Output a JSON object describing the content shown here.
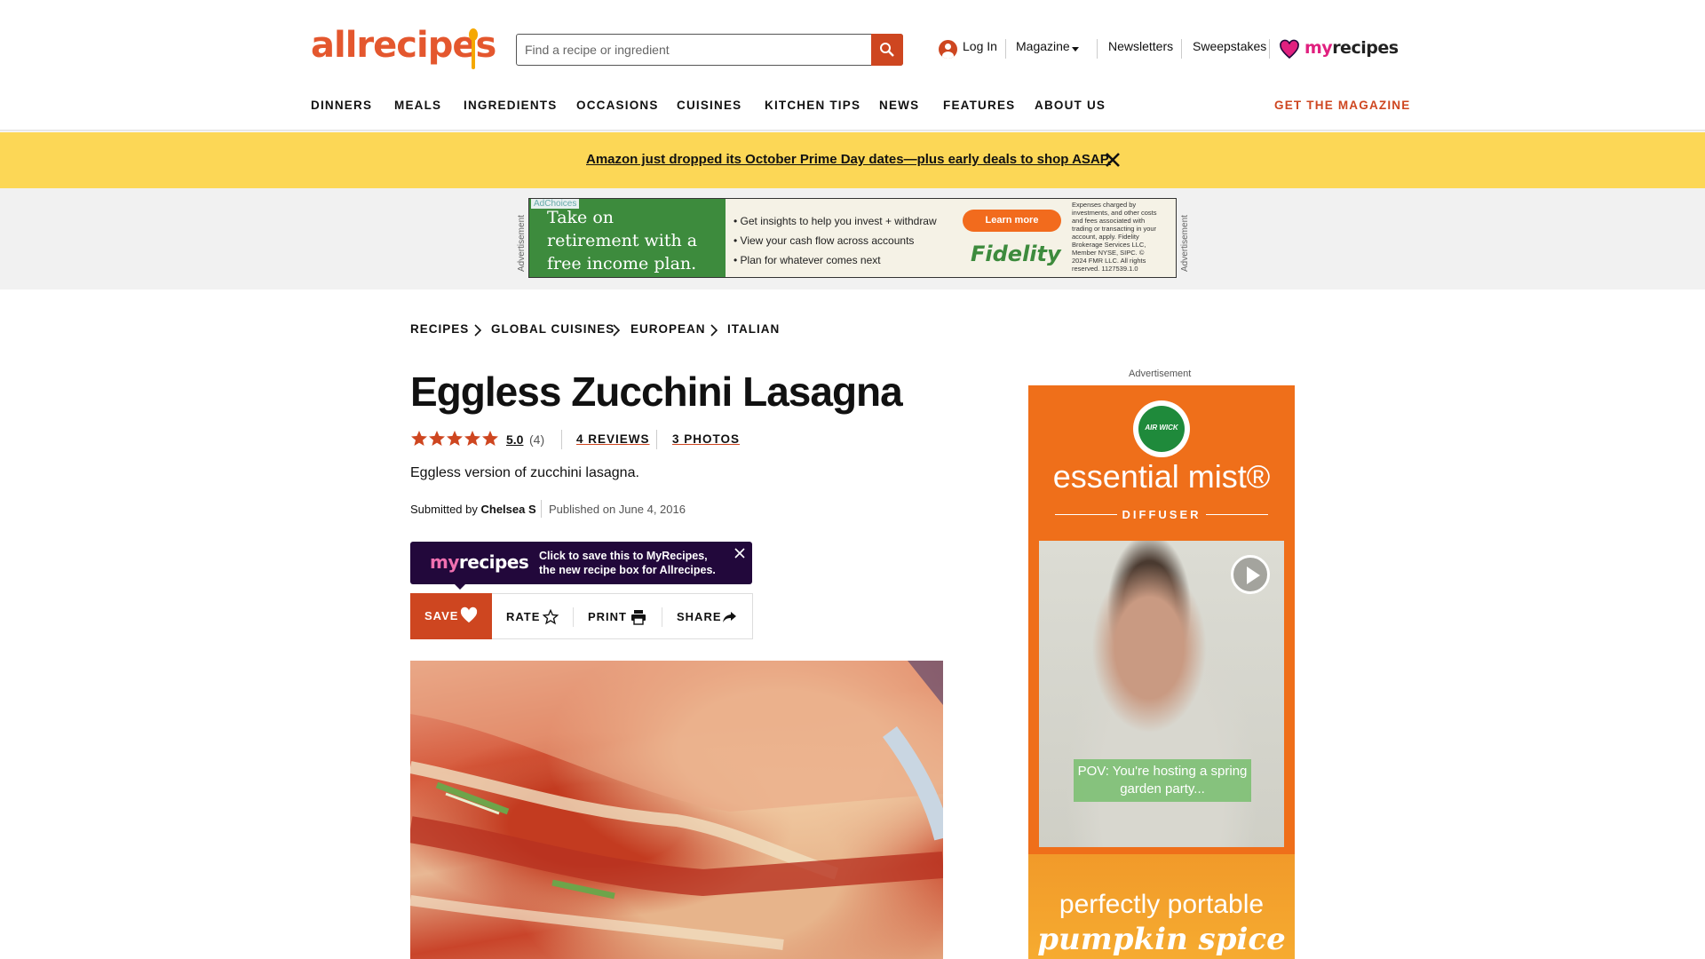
{
  "header": {
    "logo": "allrecipes",
    "search_placeholder": "Find a recipe or ingredient",
    "login": "Log In",
    "magazine": "Magazine",
    "newsletters": "Newsletters",
    "sweepstakes": "Sweepstakes",
    "myrecipes_my": "my",
    "myrecipes_rec": "recipes"
  },
  "nav": {
    "items": [
      "DINNERS",
      "MEALS",
      "INGREDIENTS",
      "OCCASIONS",
      "CUISINES",
      "KITCHEN TIPS",
      "NEWS",
      "FEATURES",
      "ABOUT US"
    ],
    "get_magazine": "GET THE MAGAZINE"
  },
  "banner": {
    "text": "Amazon just dropped its October Prime Day dates—plus early deals to shop ASAP."
  },
  "top_ad": {
    "label": "Advertisement",
    "adchoices": "AdChoices",
    "headline": "Take on retirement with a free income plan.",
    "bullets": [
      "• Get insights to help you invest + withdraw",
      "• View your cash flow across accounts",
      "• Plan for whatever comes next"
    ],
    "cta": "Learn more",
    "brand": "Fidelity",
    "fine_print": "Expenses charged by investments, and other costs and fees associated with trading or transacting in your account, apply. Fidelity Brokerage Services LLC, Member NYSE, SIPC. © 2024 FMR LLC. All rights reserved. 1127539.1.0"
  },
  "breadcrumb": [
    "RECIPES",
    "GLOBAL CUISINES",
    "EUROPEAN",
    "ITALIAN"
  ],
  "recipe": {
    "title": "Eggless Zucchini Lasagna",
    "rating": "5.0",
    "rating_value": 5,
    "rating_count": "(4)",
    "reviews": "4 REVIEWS",
    "photos": "3 PHOTOS",
    "description": "Eggless version of zucchini lasagna.",
    "submitted_by_label": "Submitted by",
    "author": "Chelsea S",
    "published": "Published on June 4, 2016"
  },
  "promo": {
    "logo_my": "my",
    "logo_rec": "recipes",
    "text_line1": "Click to save this to MyRecipes,",
    "text_line2": "the new recipe box for Allrecipes."
  },
  "actions": {
    "save": "SAVE",
    "rate": "RATE",
    "print": "PRINT",
    "share": "SHARE"
  },
  "side_ad": {
    "label": "Advertisement",
    "brand_badge": "AIR WICK",
    "product": "essential mist®",
    "subtitle": "DIFFUSER",
    "video_caption": "POV: You're hosting a spring garden party...",
    "tagline": "perfectly portable",
    "scent": "pumpkin spice"
  },
  "colors": {
    "brand_orange": "#ce4620",
    "banner_yellow": "#fcd756",
    "myrecipes_pink": "#e0207f"
  }
}
